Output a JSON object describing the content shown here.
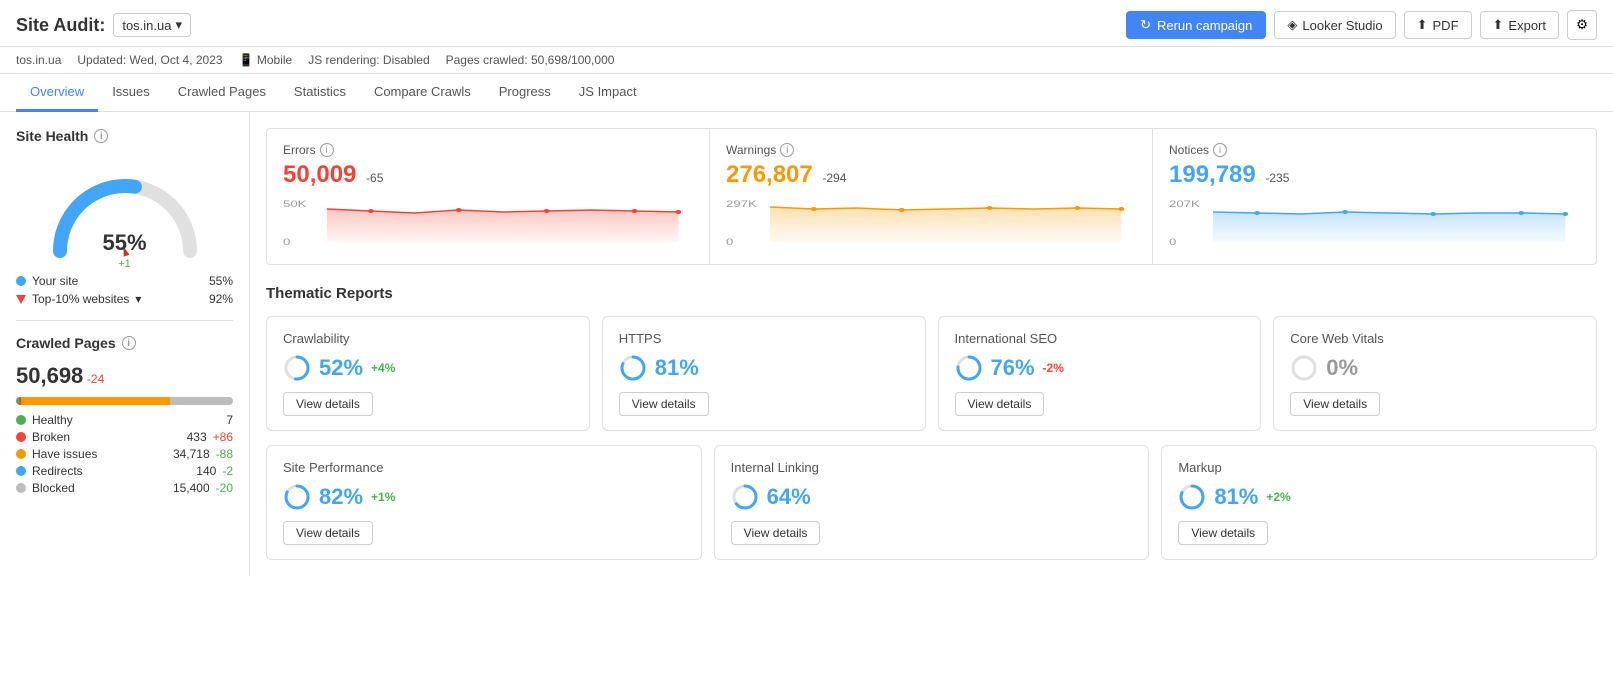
{
  "header": {
    "title": "Site Audit:",
    "site_selector": "tos.in.ua",
    "site_selector_arrow": "▾",
    "meta": {
      "updated": "Updated: Wed, Oct 4, 2023",
      "device": "Mobile",
      "js_rendering": "JS rendering: Disabled",
      "pages_crawled": "Pages crawled: 50,698/100,000"
    },
    "buttons": {
      "rerun": "Rerun campaign",
      "looker": "Looker Studio",
      "pdf": "PDF",
      "export": "Export"
    }
  },
  "nav": {
    "tabs": [
      "Overview",
      "Issues",
      "Crawled Pages",
      "Statistics",
      "Compare Crawls",
      "Progress",
      "JS Impact"
    ],
    "active": "Overview"
  },
  "site_health": {
    "title": "Site Health",
    "percent": "55%",
    "delta": "+1",
    "legend": [
      {
        "label": "Your site",
        "value": "55%",
        "type": "dot",
        "color": "#42a5f5"
      },
      {
        "label": "Top-10% websites",
        "value": "92%",
        "type": "tri",
        "color": "#f44336"
      }
    ]
  },
  "crawled_pages": {
    "title": "Crawled Pages",
    "count": "50,698",
    "delta": "-24",
    "bars": [
      {
        "type": "healthy",
        "color": "#4caf50",
        "pct": 0.014
      },
      {
        "type": "broken",
        "color": "#f44336",
        "pct": 0.009
      },
      {
        "type": "issues",
        "color": "#ff9800",
        "pct": 0.686
      },
      {
        "type": "redirects",
        "color": "#42a5f5",
        "pct": 0.003
      },
      {
        "type": "blocked",
        "color": "#bdbdbd",
        "pct": 0.288
      }
    ],
    "legend": [
      {
        "label": "Healthy",
        "count": "7",
        "change": "",
        "change_type": ""
      },
      {
        "label": "Broken",
        "count": "433",
        "change": "+86",
        "change_type": "pos"
      },
      {
        "label": "Have issues",
        "count": "34,718",
        "change": "-88",
        "change_type": "neg"
      },
      {
        "label": "Redirects",
        "count": "140",
        "change": "-2",
        "change_type": "neg"
      },
      {
        "label": "Blocked",
        "count": "15,400",
        "change": "-20",
        "change_type": "neg"
      }
    ],
    "dot_colors": [
      "#4caf50",
      "#f44336",
      "#ff9800",
      "#42a5f5",
      "#bdbdbd"
    ]
  },
  "stats": {
    "errors": {
      "label": "Errors",
      "count": "50,009",
      "delta": "-65",
      "color": "#f44336",
      "chart_max": "50K",
      "chart_min": "0"
    },
    "warnings": {
      "label": "Warnings",
      "count": "276,807",
      "delta": "-294",
      "color": "#ff9800",
      "chart_max": "297K",
      "chart_min": "0"
    },
    "notices": {
      "label": "Notices",
      "count": "199,789",
      "delta": "-235",
      "color": "#42a5f5",
      "chart_max": "207K",
      "chart_min": "0"
    }
  },
  "thematic_reports": {
    "title": "Thematic Reports",
    "row1": [
      {
        "title": "Crawlability",
        "score": "52%",
        "delta": "+4%",
        "delta_type": "pos",
        "color": "blue"
      },
      {
        "title": "HTTPS",
        "score": "81%",
        "delta": "",
        "delta_type": "",
        "color": "blue"
      },
      {
        "title": "International SEO",
        "score": "76%",
        "delta": "-2%",
        "delta_type": "neg",
        "color": "blue"
      },
      {
        "title": "Core Web Vitals",
        "score": "0%",
        "delta": "",
        "delta_type": "",
        "color": "gray"
      }
    ],
    "row2": [
      {
        "title": "Site Performance",
        "score": "82%",
        "delta": "+1%",
        "delta_type": "pos",
        "color": "blue"
      },
      {
        "title": "Internal Linking",
        "score": "64%",
        "delta": "",
        "delta_type": "",
        "color": "blue"
      },
      {
        "title": "Markup",
        "score": "81%",
        "delta": "+2%",
        "delta_type": "pos",
        "color": "blue"
      }
    ],
    "view_details_label": "View details"
  }
}
